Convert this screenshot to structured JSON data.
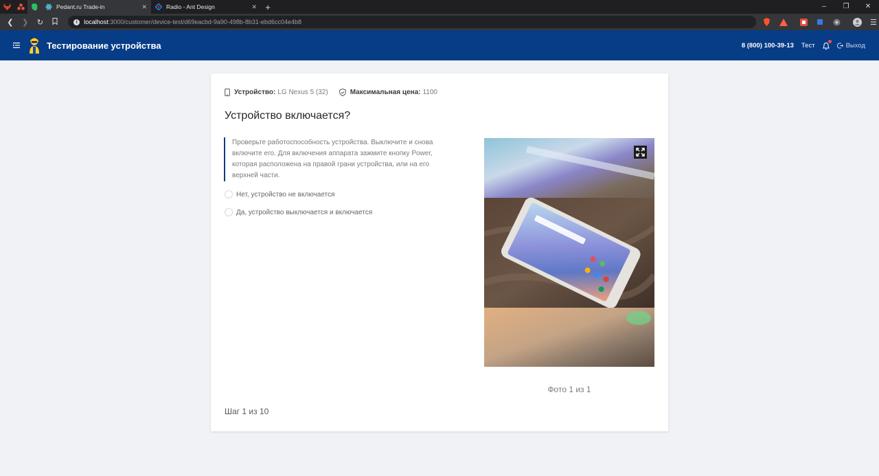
{
  "browser": {
    "tabs": [
      {
        "title": "Pedant.ru Trade-in",
        "active": true
      },
      {
        "title": "Radio - Ant Design",
        "active": false
      }
    ],
    "url_host": "localhost",
    "url_path": ":3000/customer/device-test/d69eacbd-9a90-498b-8b31-ebd6cc04e4b8"
  },
  "header": {
    "title": "Тестирование устройства",
    "phone": "8 (800) 100-39-13",
    "user": "Тест",
    "logout": "Выход",
    "color": "#073c86"
  },
  "device": {
    "label": "Устройство:",
    "value": "LG Nexus 5 (32)",
    "price_label": "Максимальная цена:",
    "price_value": "1100"
  },
  "question": {
    "title": "Устройство включается?",
    "hint": "Проверьте работоспособность устройства. Выключите и снова включите его. Для включения аппарата зажмите кнопку Power, которая расположена на правой грани устройства, или на его верхней части.",
    "options": [
      {
        "label": "Нет, устройство не включается",
        "checked": false
      },
      {
        "label": "Да, устройство выключается и включается",
        "checked": false
      }
    ]
  },
  "photo": {
    "counter": "Фото 1 из 1"
  },
  "step": "Шаг 1 из 10"
}
